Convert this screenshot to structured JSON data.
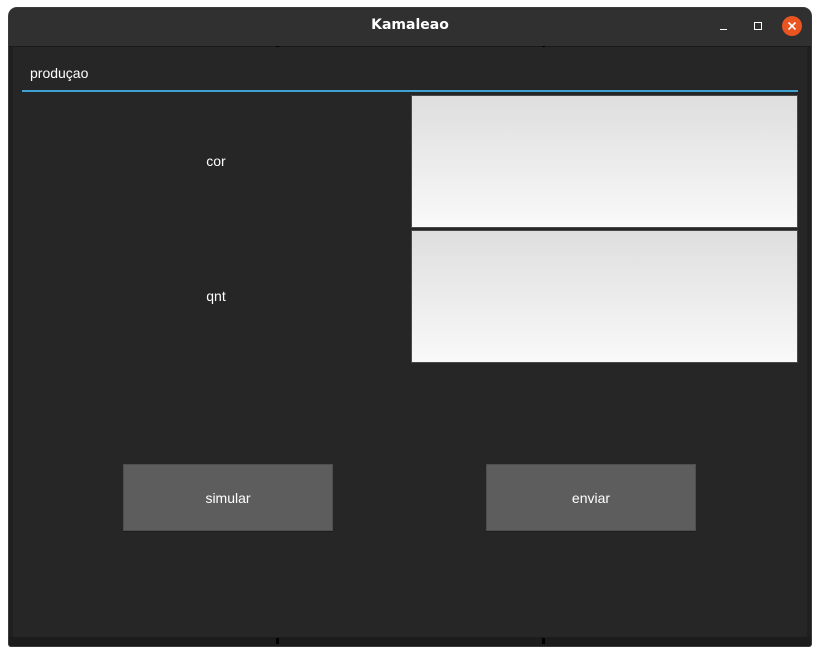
{
  "window": {
    "title": "Kamaleao",
    "controls": {
      "minimize": "minimize-icon",
      "maximize": "maximize-icon",
      "close": "close-icon"
    },
    "close_color": "#e95420"
  },
  "section": {
    "label": "produçao",
    "accent_color": "#3fa2d3"
  },
  "fields": [
    {
      "label": "cor"
    },
    {
      "label": "qnt"
    }
  ],
  "buttons": {
    "simular": "simular",
    "enviar": "enviar"
  }
}
